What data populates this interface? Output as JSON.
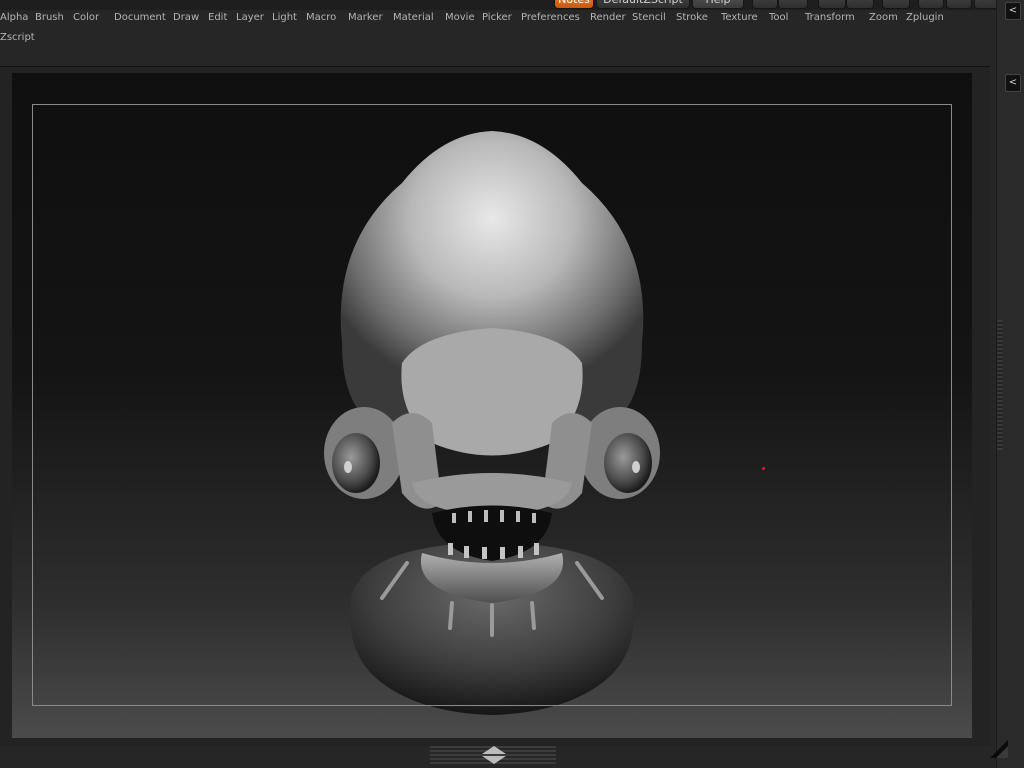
{
  "top_strip": {
    "notes_label": "Notes",
    "default_script_label": "DefaultZScript",
    "help_label": "Help"
  },
  "menubar": {
    "items": [
      "Alpha",
      "Brush",
      "Color",
      "Document",
      "Draw",
      "Edit",
      "Layer",
      "Light",
      "Macro",
      "Marker",
      "Material",
      "Movie",
      "Picker",
      "Preferences",
      "Render",
      "Stencil",
      "Stroke",
      "Texture",
      "Tool",
      "Transform",
      "Zoom",
      "Zplugin"
    ],
    "row2": [
      "Zscript"
    ]
  },
  "right_tray": {
    "collapse_top": "<",
    "collapse_canvas": "<"
  },
  "colors": {
    "accent": "#e8741c",
    "menu_text": "#b4b4b4",
    "ui_bg": "#262626",
    "canvas_top": "#0f0f0f",
    "canvas_bottom": "#4b4b4b",
    "brush_cursor": "#e02020"
  },
  "icons": [
    "chevron-left-icon",
    "window-minimize-icon",
    "window-restore-icon",
    "close-icon",
    "resize-corner-icon",
    "arrow-up-down-icon"
  ]
}
